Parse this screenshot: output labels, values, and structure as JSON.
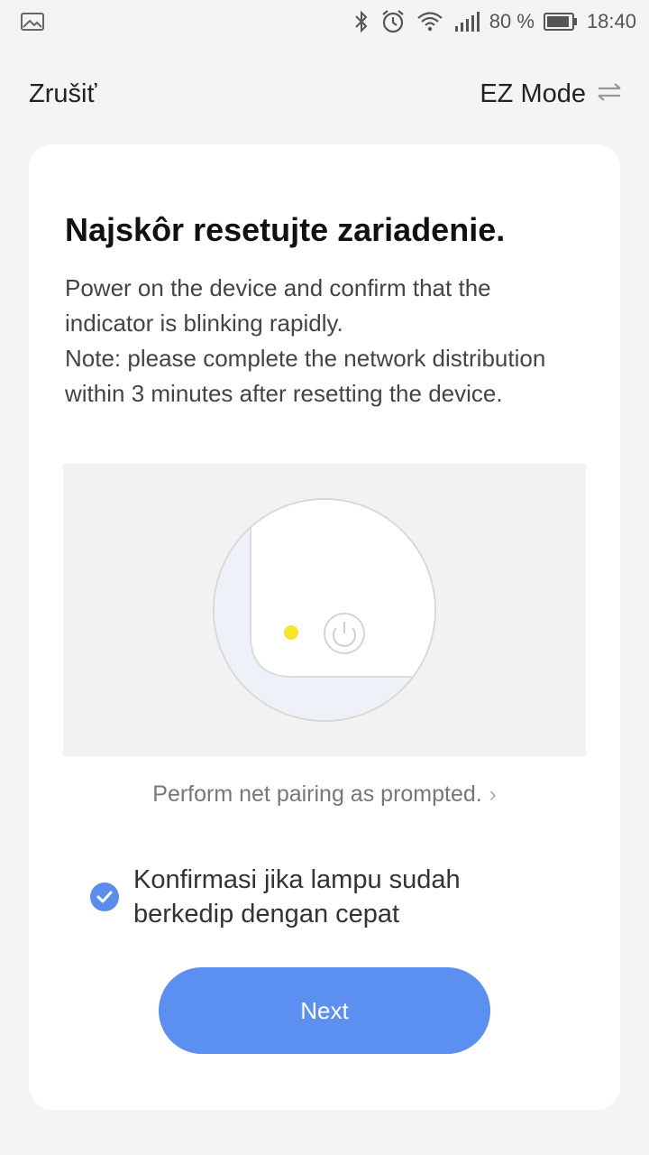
{
  "status_bar": {
    "battery_percent": "80 %",
    "time": "18:40",
    "icons": [
      "image-icon",
      "bluetooth-icon",
      "alarm-icon",
      "wifi-icon",
      "signal-icon",
      "battery-icon"
    ]
  },
  "header": {
    "cancel_label": "Zrušiť",
    "mode_label": "EZ Mode"
  },
  "content": {
    "title": "Najskôr resetujte zariadenie.",
    "description_line1": "Power on the device and confirm that the indicator is blinking rapidly.",
    "description_line2": "Note: please complete the network distribution within 3 minutes after resetting the device.",
    "pairing_link": "Perform net pairing as prompted.",
    "confirm_label": "Konfirmasi jika lampu sudah berkedip dengan cepat",
    "confirm_checked": true,
    "next_button": "Next"
  },
  "colors": {
    "accent": "#5b8ff0",
    "indicator_led": "#f5e62a",
    "background": "#f4f4f4"
  }
}
